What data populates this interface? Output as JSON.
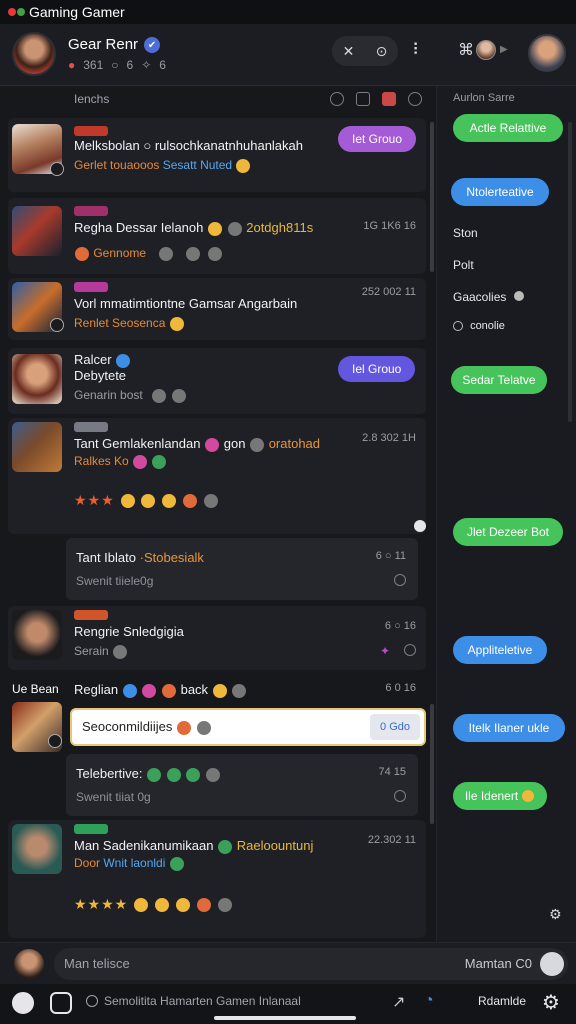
{
  "status_bar": {
    "app_name": "Gaming Gamer"
  },
  "header": {
    "name": "Gear Renr",
    "meta_a": "361",
    "meta_b": "6",
    "meta_c": "6"
  },
  "left_panel": {
    "subbar_label": "Ienchs",
    "cards": [
      {
        "title": "Melksbolan ○ rulsochkanatnhuhanlakah",
        "sub_orange": "Gerlet touaooos",
        "sub_blue": "Sesatt Nuted",
        "pill": "Iet Grouo",
        "tag_color": "#c0392b"
      },
      {
        "title": "Regha Dessar Ielanoh",
        "title_tail": "2otdgh811s",
        "sub": "Gennome",
        "time": "1G 1K6 16",
        "tag_color": "#a0306a"
      },
      {
        "title": "Vorl mmatimtiontne Gamsar Angarbain",
        "sub": "Renlet Seosenca",
        "time": "252 002 11",
        "tag_color": "#b63a9a"
      },
      {
        "title": "Ralcer",
        "title2": "Debytete",
        "sub_grey": "Genarin bost",
        "pill": "Iel Grouo"
      },
      {
        "title": "Tant Gemlakenlandan",
        "title_mid": "gon",
        "title_tail": "oratohad",
        "sub": "Ralkes Ko",
        "time": "2.8 302 1H",
        "stars": "★★★",
        "tag_color": "#777a84"
      },
      {
        "reply_title": "Tant Iblato",
        "reply_title_or": "·Stobesialk",
        "reply_sub": "Swenit tiiele0g",
        "reply_time": "6 ○ 11"
      },
      {
        "title": "Rengrie Snledgigia",
        "sub_grey": "Serain",
        "time": "6 ○ 16",
        "tag_color": "#d0552a"
      },
      {
        "side_label": "Ue Bean",
        "title": "Reglian",
        "title_tail": "back",
        "time": "6 0 16",
        "input_text": "Seoconmildiijes",
        "input_btn": "0 Gdo"
      },
      {
        "reply_title": "Telebertive:",
        "reply_sub": "Swenit tiiat 0g",
        "reply_time": "74 15"
      },
      {
        "title": "Man Sadenikanumikaan",
        "title_tail": "Raeloountunj",
        "sub_orange": "Door",
        "sub_blue": "Wnit laonldi",
        "time": "22.302 11",
        "stars": "★★★★",
        "tag_color": "#2ea05a"
      }
    ]
  },
  "right_panel": {
    "heading": "Aurlon Sarre",
    "items": [
      {
        "label": "Actle Relattive",
        "color": "green"
      },
      {
        "label": "Ntolerteative",
        "color": "blue"
      },
      {
        "label": "Ston",
        "type": "text"
      },
      {
        "label": "Polt",
        "type": "text"
      },
      {
        "label": "Gaacolies",
        "type": "text"
      },
      {
        "label": "conolie",
        "type": "text"
      },
      {
        "label": "Sedar Telatve",
        "color": "green"
      },
      {
        "label": "Jlet Dezeer Bot",
        "color": "green"
      },
      {
        "label": "Appliteletive",
        "color": "blue"
      },
      {
        "label": "Itelk Ilaner ukle",
        "color": "blue"
      },
      {
        "label": "Ile Idenert",
        "color": "green"
      }
    ]
  },
  "composer": {
    "placeholder": "Man telisce",
    "right_text": "Mamtan C0"
  },
  "navbar": {
    "status_text": "Semolitita Hamarten Gamen Inlanaal",
    "button_label": "Rdamlde"
  },
  "colors": {
    "bg": "#16171b",
    "accent_green": "#47c35c",
    "accent_blue": "#3d8ee6",
    "accent_purple": "#a55ad6",
    "accent_indigo": "#6357e0",
    "orange_text": "#e58a3a"
  },
  "icons": [
    "notification-icon",
    "edit-icon",
    "settings-icon",
    "tools-icon",
    "search-icon",
    "more-icon",
    "share-icon",
    "mic-icon",
    "home-icon",
    "camera-icon",
    "gear-icon"
  ]
}
